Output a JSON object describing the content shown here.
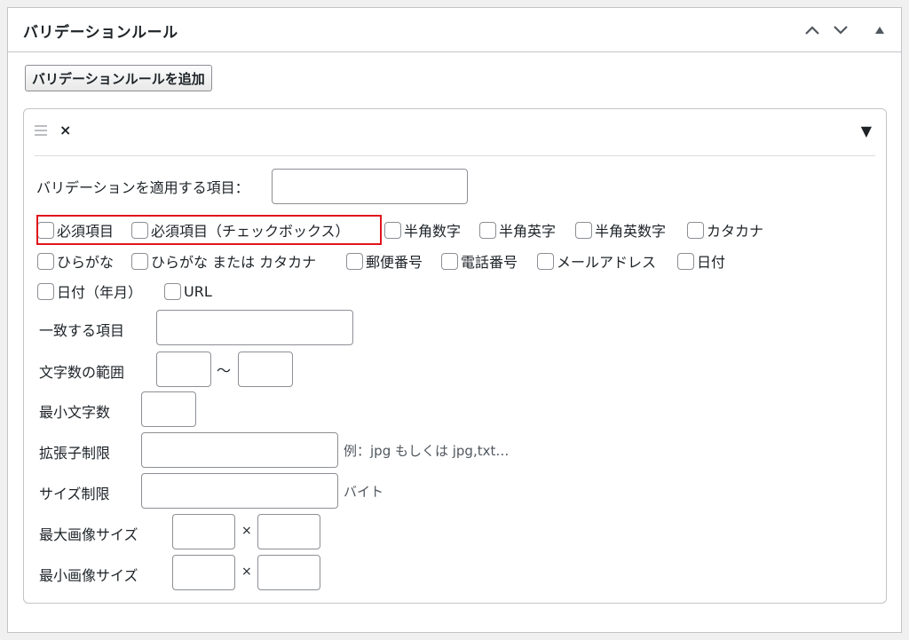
{
  "postbox": {
    "title": "バリデーションルール",
    "controls": {
      "up": "∧",
      "down": "∨",
      "toggle": "▲"
    }
  },
  "add_button_label": "バリデーションルールを追加",
  "rule": {
    "remove_label": "×",
    "toggle_symbol": "▼",
    "target_field_label": "バリデーションを適用する項目：",
    "target_field_value": "",
    "checkboxes": [
      "必須項目",
      "必須項目（チェックボックス）",
      "半角数字",
      "半角英字",
      "半角英数字",
      "カタカナ",
      "ひらがな",
      "ひらがな または カタカナ",
      "郵便番号",
      "電話番号",
      "メールアドレス",
      "日付",
      "日付（年月）",
      "URL"
    ],
    "match_label": "一致する項目",
    "length_range_label": "文字数の範囲",
    "range_separator": "〜",
    "min_length_label": "最小文字数",
    "extension_label": "拡張子制限",
    "extension_hint": "例：jpg もしくは jpg,txt…",
    "size_label": "サイズ制限",
    "size_unit": "バイト",
    "max_image_label": "最大画像サイズ",
    "min_image_label": "最小画像サイズ",
    "times_symbol": "×"
  },
  "colors": {
    "highlight": "#e0141c",
    "border": "#8c8f94"
  }
}
